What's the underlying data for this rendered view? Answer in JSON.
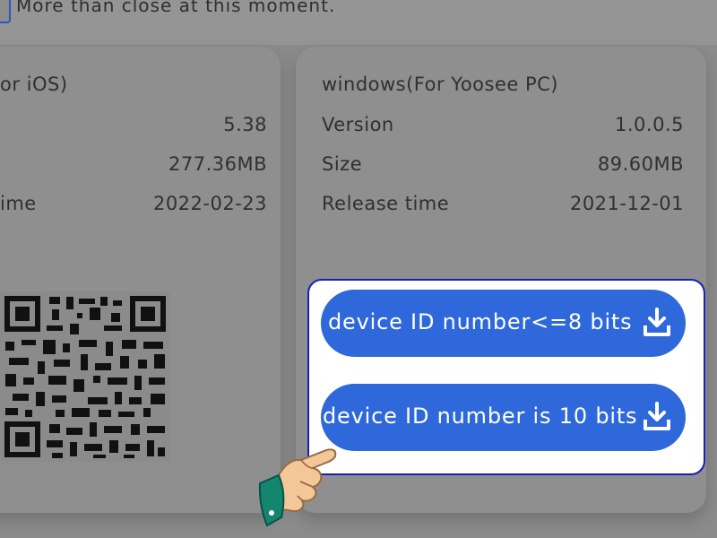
{
  "top_notice": {
    "text": "More than close at this moment."
  },
  "ios_card": {
    "title": "or iOS)",
    "rows": [
      {
        "label": "",
        "value": "5.38"
      },
      {
        "label": "",
        "value": "277.36MB"
      },
      {
        "label": "ime",
        "value": "2022-02-23"
      }
    ]
  },
  "windows_card": {
    "title": "windows(For Yoosee PC)",
    "rows": [
      {
        "label": "Version",
        "value": "1.0.0.5"
      },
      {
        "label": "Size",
        "value": "89.60MB"
      },
      {
        "label": "Release time",
        "value": "2021-12-01"
      }
    ]
  },
  "downloads": {
    "button_8_bits": "device ID number<=8 bits",
    "button_10_bits": "device ID number is 10 bits"
  },
  "colors": {
    "accent": "#2f68db",
    "highlight_border": "#1620b9",
    "overlay": "#8b8b8b"
  },
  "icons": [
    "download-icon",
    "pointing-hand-icon",
    "qr-code",
    "checkbox"
  ]
}
